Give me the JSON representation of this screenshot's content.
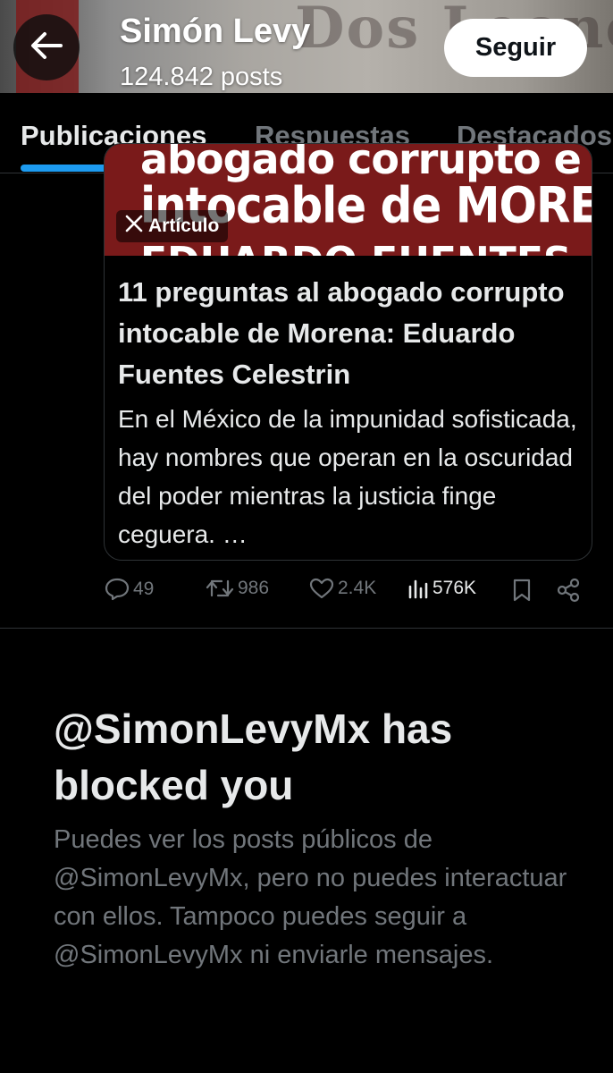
{
  "header": {
    "name": "Simón Levy",
    "posts_count": "124.842 posts",
    "follow_label": "Seguir",
    "banner_text": "Dos Leones"
  },
  "tabs": [
    {
      "label": "Publicaciones",
      "active": true
    },
    {
      "label": "Respuestas",
      "active": false
    },
    {
      "label": "Destacados",
      "active": false
    }
  ],
  "article": {
    "image_text": {
      "line1": "abogado corrupto e",
      "line2": "intocable de MORENA:",
      "line3": "EDUARDO FUENTES"
    },
    "badge_label": "Artículo",
    "title": "11 preguntas al abogado corrupto intocable de Morena: Eduardo Fuentes Celestrin",
    "description": "En el México de la impunidad sofisticada, hay nombres que operan en la oscuridad del poder mientras la justicia finge ceguera. …"
  },
  "actions": {
    "replies": "49",
    "reposts": "986",
    "likes": "2.4K",
    "views": "576K"
  },
  "blocked": {
    "title": "@SimonLevyMx has blocked you",
    "message": "Puedes ver los posts públicos de @SimonLevyMx, pero no puedes interactuar con ellos. Tampoco puedes seguir a @SimonLevyMx ni enviarle mensajes."
  },
  "colors": {
    "accent": "#1d9bf0",
    "background": "#000000",
    "text_primary": "#e7e9ea",
    "text_secondary": "#71767b",
    "banner_red": "#7a1a1a"
  }
}
